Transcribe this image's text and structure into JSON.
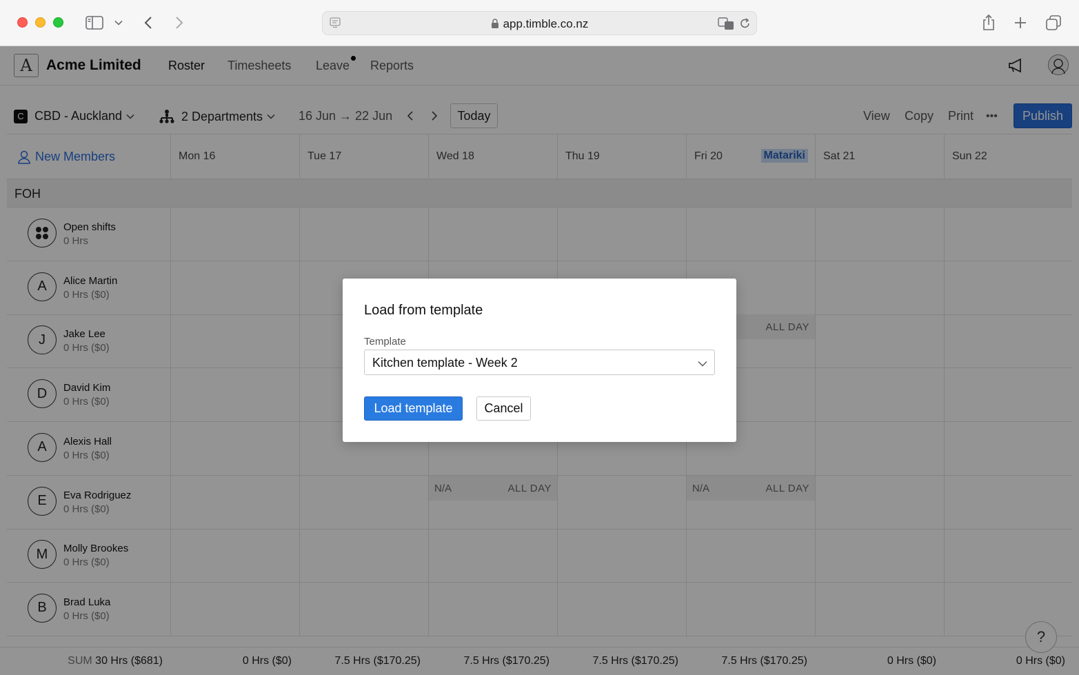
{
  "browser": {
    "url": "app.timble.co.nz"
  },
  "nav": {
    "company": "Acme Limited",
    "links": [
      "Roster",
      "Timesheets",
      "Leave",
      "Reports"
    ]
  },
  "toolbar": {
    "location_badge": "C",
    "location": "CBD - Auckland",
    "departments": "2 Departments",
    "date_range": "16 Jun → 22 Jun",
    "today": "Today",
    "view": "View",
    "copy": "Copy",
    "print": "Print",
    "more": "•••",
    "publish": "Publish"
  },
  "grid": {
    "new_members": "New Members",
    "days": [
      "Mon 16",
      "Tue 17",
      "Wed 18",
      "Thu 19",
      "Fri 20",
      "Sat 21",
      "Sun 22"
    ],
    "holiday": "Matariki",
    "department": "FOH",
    "members": [
      {
        "initial": "",
        "name": "Open shifts",
        "hours": "0 Hrs"
      },
      {
        "initial": "A",
        "name": "Alice Martin",
        "hours": "0 Hrs ($0)"
      },
      {
        "initial": "J",
        "name": "Jake Lee",
        "hours": "0 Hrs ($0)"
      },
      {
        "initial": "D",
        "name": "David Kim",
        "hours": "0 Hrs ($0)"
      },
      {
        "initial": "A",
        "name": "Alexis Hall",
        "hours": "0 Hrs ($0)"
      },
      {
        "initial": "E",
        "name": "Eva Rodriguez",
        "hours": "0 Hrs ($0)"
      },
      {
        "initial": "M",
        "name": "Molly Brookes",
        "hours": "0 Hrs ($0)"
      },
      {
        "initial": "B",
        "name": "Brad Luka",
        "hours": "0 Hrs ($0)"
      }
    ],
    "notes": {
      "all_day": "ALL DAY",
      "na": "N/A"
    }
  },
  "footer": {
    "sum_label": "SUM",
    "sum_total": "30 Hrs ($681)",
    "totals": [
      "0 Hrs ($0)",
      "7.5 Hrs ($170.25)",
      "7.5 Hrs ($170.25)",
      "7.5 Hrs ($170.25)",
      "7.5 Hrs ($170.25)",
      "0 Hrs ($0)",
      "0 Hrs ($0)"
    ]
  },
  "help": "?",
  "modal": {
    "title": "Load from template",
    "field_label": "Template",
    "selected": "Kitchen template - Week 2",
    "load": "Load template",
    "cancel": "Cancel"
  }
}
